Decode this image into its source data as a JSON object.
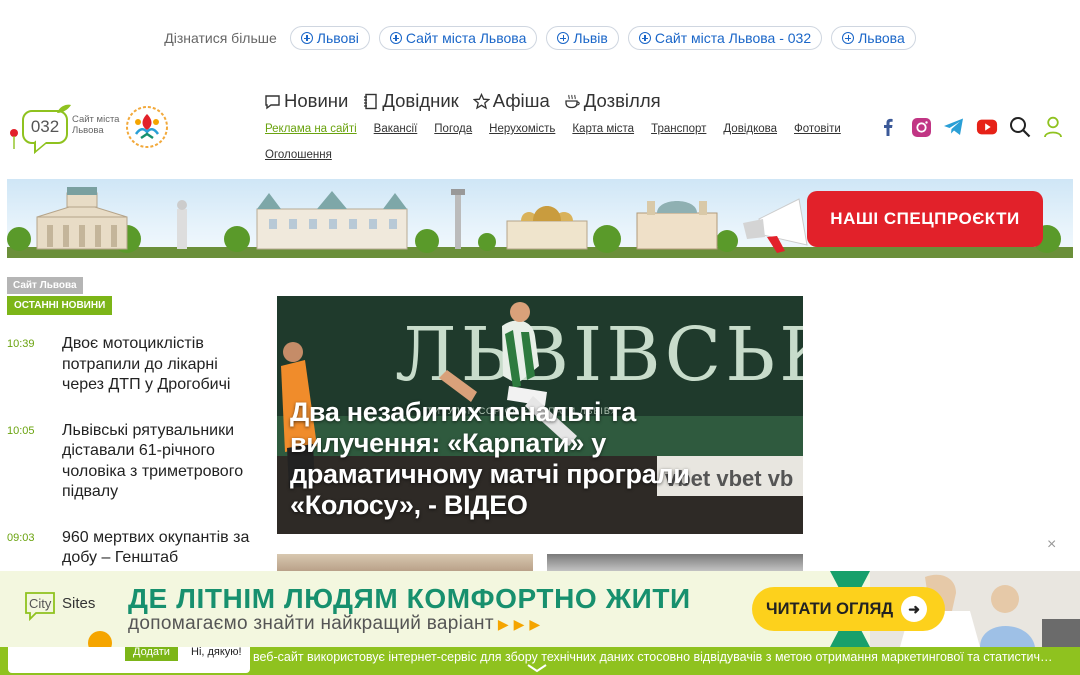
{
  "learn_more": {
    "label": "Дізнатися більше",
    "pills": [
      "Львові",
      "Сайт міста Львова",
      "Львів",
      "Сайт міста Львова - 032",
      "Львова"
    ]
  },
  "logo": {
    "number": "032",
    "text": "Сайт міста Львова"
  },
  "main_nav": [
    {
      "label": "Новини",
      "icon": "chat-icon"
    },
    {
      "label": "Довідник",
      "icon": "notebook-icon"
    },
    {
      "label": "Афіша",
      "icon": "star-icon"
    },
    {
      "label": "Дозвілля",
      "icon": "cup-icon"
    }
  ],
  "sub_nav": [
    "Реклама на сайті",
    "Вакансії",
    "Погода",
    "Нерухомість",
    "Карта міста",
    "Транспорт",
    "Довідкова",
    "Фотовіти",
    "Оголошення"
  ],
  "social": {
    "icons": [
      "facebook-icon",
      "instagram-icon",
      "telegram-icon",
      "youtube-icon",
      "search-icon",
      "user-icon"
    ],
    "colors": {
      "facebook": "#3b5998",
      "instagram": "#c13584",
      "telegram": "#2a9fd6",
      "youtube": "#e62117",
      "accent": "#8fc21f"
    }
  },
  "banner": {
    "cta": "НАШІ СПЕЦПРОЄКТИ"
  },
  "left": {
    "site_tag": "Сайт Львова",
    "news_tag": "ОСТАННІ НОВИНИ",
    "news": [
      {
        "time": "10:39",
        "title": "Двоє мотоциклістів потрапили до лікарні через ДТП у Дрогобичі"
      },
      {
        "time": "10:05",
        "title": "Львівські рятувальники діставали 61-річного чоловіка з триметрового підвалу"
      },
      {
        "time": "09:03",
        "title": "960 мертвих окупантів за добу – Генштаб"
      }
    ]
  },
  "featured": {
    "headline": "Два незабитих пенальті та вилучення: «Карпати» у драматичному матчі програли «Колосу», - ВІДЕО",
    "photo_sign": "ЛЬВІВСЬКЕ",
    "photo_subsign": "ТИТУЛЬН    СОР ФК «КАРПАТИ ЛЬВІВ»",
    "photo_board": "vbet vbet vb"
  },
  "close_symbol": "×",
  "ad": {
    "logo_city": "City",
    "logo_sites": "Sites",
    "headline": "ДЕ ЛІТНІМ ЛЮДЯМ КОМФОРТНО ЖИТИ",
    "subline": "допомагаємо знайти найкращий варіант",
    "button": "ЧИТАТИ ОГЛЯД",
    "colors": {
      "headline": "#17906e",
      "button": "#fdd11c"
    }
  },
  "cookie": {
    "accept": "Додати",
    "thanks": "Ні, дякую!",
    "text": "веб-сайт використовує інтернет-сервіс для збору технічних даних стосовно відвідувачів з метою отримання маркетингової та статистичної інформації"
  }
}
